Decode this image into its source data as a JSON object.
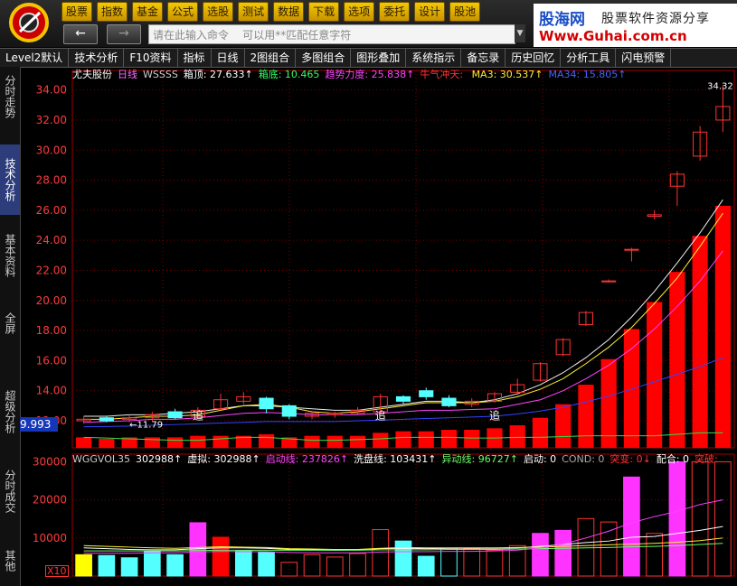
{
  "menu": [
    "股票",
    "指数",
    "基金",
    "公式",
    "选股",
    "测试",
    "数据",
    "下载",
    "选项",
    "委托",
    "设计",
    "股池"
  ],
  "command": {
    "placeholder": "请在此输入命令    可以用**匹配任意字符"
  },
  "nav": {
    "back": "←",
    "forward": "→"
  },
  "brand": {
    "name": "股海网",
    "slogan": "股票软件资源分享",
    "url": "Www.Guhai.com.cn"
  },
  "toolbar": [
    "Level2默认",
    "技术分析",
    "F10资料",
    "指标",
    "日线",
    "2图组合",
    "多图组合",
    "图形叠加",
    "系统指示",
    "备忘录",
    "历史回忆",
    "分析工具",
    "闪电预警"
  ],
  "left_tabs": [
    "分时走势",
    "技术分析",
    "基本资料",
    "全屏",
    "超级分析",
    "分时成交",
    "其他"
  ],
  "main_legend": [
    {
      "text": "尤夫股份",
      "color": "#ffffff"
    },
    {
      "text": "日线",
      "color": "#ff66ff"
    },
    {
      "text": "WSSSS",
      "color": "#cccccc"
    },
    {
      "text": "箱顶: 27.633↑",
      "color": "#ffffff"
    },
    {
      "text": "箱底: 10.465",
      "color": "#33ff66"
    },
    {
      "text": "趋势力度: 25.838↑",
      "color": "#ff44ff"
    },
    {
      "text": "牛气冲天: ",
      "color": "#ff3333"
    },
    {
      "text": "MA3: 30.537↑",
      "color": "#ffee33"
    },
    {
      "text": "MA34: 15.805↑",
      "color": "#4466ff"
    }
  ],
  "vol_legend": [
    {
      "text": "WGGVOL35",
      "color": "#cccccc"
    },
    {
      "text": "302988↑",
      "color": "#ffffff"
    },
    {
      "text": "虚拟: 302988↑",
      "color": "#ffffff"
    },
    {
      "text": "启动线: 237826↑",
      "color": "#ff44ff"
    },
    {
      "text": "洗盘线: 103431↑",
      "color": "#ffffff"
    },
    {
      "text": "异动线: 96727↑",
      "color": "#66ff66"
    },
    {
      "text": "启动: 0",
      "color": "#ffffff"
    },
    {
      "text": "COND: 0",
      "color": "#aaaaaa"
    },
    {
      "text": "突变: 0↓",
      "color": "#ff3333"
    },
    {
      "text": "配合: 0",
      "color": "#ffffff"
    },
    {
      "text": "突破: ",
      "color": "#ff3333"
    }
  ],
  "current_price_label": "9.993",
  "annotations": {
    "low_price": "←11.79",
    "high_price": "34.32",
    "zhui": "追"
  },
  "volume_scale_label": "X10",
  "colors": {
    "up": "#ff3333",
    "down": "#54ffff",
    "ma_white": "#f0f0f0",
    "ma_yellow": "#ffee33",
    "ma_blue": "#3344ff",
    "ma_green": "#33dd44",
    "ma_magenta": "#ff44ff",
    "grid": "#7a0000"
  },
  "chart_data": [
    {
      "type": "candlestick",
      "title": "",
      "ylim": [
        10.2,
        35.3
      ],
      "y_ticks": [
        34,
        32,
        30,
        28,
        26,
        24,
        22,
        20,
        18,
        16,
        14,
        12
      ],
      "y_tick_labels": [
        "34.00",
        "32.00",
        "30.00",
        "28.00",
        "26.00",
        "24.00",
        "22.00",
        "20.00",
        "18.00",
        "16.00",
        "14.00",
        "12.00"
      ],
      "candles": [
        {
          "o": 12.0,
          "c": 12.1,
          "h": 12.3,
          "l": 11.8
        },
        {
          "o": 12.2,
          "c": 12.0,
          "h": 12.3,
          "l": 11.9
        },
        {
          "o": 12.1,
          "c": 12.2,
          "h": 12.4,
          "l": 11.9
        },
        {
          "o": 12.2,
          "c": 12.4,
          "h": 12.6,
          "l": 12.0
        },
        {
          "o": 12.6,
          "c": 12.2,
          "h": 12.8,
          "l": 12.1
        },
        {
          "o": 12.3,
          "c": 12.7,
          "h": 12.9,
          "l": 12.2
        },
        {
          "o": 12.8,
          "c": 13.4,
          "h": 13.8,
          "l": 12.7
        },
        {
          "o": 13.3,
          "c": 13.6,
          "h": 13.9,
          "l": 13.1
        },
        {
          "o": 13.5,
          "c": 12.8,
          "h": 13.6,
          "l": 12.5
        },
        {
          "o": 13.0,
          "c": 12.3,
          "h": 13.1,
          "l": 12.1
        },
        {
          "o": 12.3,
          "c": 12.5,
          "h": 12.6,
          "l": 12.1
        },
        {
          "o": 12.4,
          "c": 12.5,
          "h": 12.6,
          "l": 12.2
        },
        {
          "o": 12.5,
          "c": 12.7,
          "h": 12.9,
          "l": 12.4
        },
        {
          "o": 12.6,
          "c": 13.6,
          "h": 13.8,
          "l": 12.5
        },
        {
          "o": 13.6,
          "c": 13.3,
          "h": 13.7,
          "l": 13.1
        },
        {
          "o": 14.0,
          "c": 13.6,
          "h": 14.2,
          "l": 13.4
        },
        {
          "o": 13.5,
          "c": 13.0,
          "h": 13.7,
          "l": 12.9
        },
        {
          "o": 13.1,
          "c": 13.3,
          "h": 13.5,
          "l": 12.9
        },
        {
          "o": 13.3,
          "c": 13.8,
          "h": 13.9,
          "l": 13.2
        },
        {
          "o": 13.9,
          "c": 14.4,
          "h": 14.8,
          "l": 13.7
        },
        {
          "o": 14.7,
          "c": 15.8,
          "h": 15.9,
          "l": 14.6
        },
        {
          "o": 16.4,
          "c": 17.4,
          "h": 17.5,
          "l": 16.3
        },
        {
          "o": 18.4,
          "c": 19.2,
          "h": 19.3,
          "l": 18.3
        },
        {
          "o": 21.3,
          "c": 21.3,
          "h": 21.4,
          "l": 21.2
        },
        {
          "o": 23.4,
          "c": 23.4,
          "h": 23.5,
          "l": 22.6
        },
        {
          "o": 25.6,
          "c": 25.7,
          "h": 26.0,
          "l": 25.4
        },
        {
          "o": 27.6,
          "c": 28.4,
          "h": 28.6,
          "l": 26.3
        },
        {
          "o": 29.6,
          "c": 31.2,
          "h": 31.6,
          "l": 29.3
        },
        {
          "o": 32.0,
          "c": 32.9,
          "h": 34.32,
          "l": 31.2
        }
      ],
      "trend_bars": [
        10.9,
        10.8,
        10.9,
        10.9,
        10.9,
        11.0,
        11.0,
        11.0,
        11.1,
        10.9,
        11.0,
        11.0,
        11.0,
        11.2,
        11.3,
        11.3,
        11.4,
        11.4,
        11.5,
        11.7,
        12.2,
        13.1,
        14.4,
        16.1,
        18.1,
        19.9,
        21.9,
        24.3,
        26.3
      ],
      "trend_base": [
        10.9,
        10.85,
        10.8,
        10.75,
        10.7,
        10.7,
        10.8,
        10.9,
        10.9,
        10.8,
        10.7,
        10.7,
        10.75,
        10.8,
        10.9,
        10.9,
        10.9,
        10.85,
        10.85,
        10.9,
        10.9,
        10.95,
        11.0,
        11.0,
        11.0,
        11.0,
        11.1,
        11.2,
        11.2
      ],
      "lines": [
        {
          "color": "#f0f0f0",
          "values": [
            12.3,
            12.3,
            12.4,
            12.4,
            12.5,
            12.6,
            12.8,
            13.0,
            13.0,
            12.9,
            12.8,
            12.7,
            12.7,
            12.9,
            13.1,
            13.3,
            13.3,
            13.2,
            13.4,
            13.8,
            14.4,
            15.2,
            16.2,
            17.4,
            18.9,
            20.6,
            22.5,
            24.5,
            26.7
          ]
        },
        {
          "color": "#ffee33",
          "values": [
            12.1,
            12.1,
            12.2,
            12.3,
            12.3,
            12.4,
            12.7,
            13.0,
            13.1,
            12.9,
            12.6,
            12.5,
            12.6,
            12.8,
            13.0,
            13.2,
            13.2,
            13.2,
            13.3,
            13.6,
            14.1,
            14.8,
            15.8,
            16.9,
            18.2,
            19.8,
            21.5,
            23.6,
            25.8
          ]
        },
        {
          "color": "#ff44ff",
          "values": [
            11.9,
            11.95,
            12.0,
            12.1,
            12.1,
            12.2,
            12.35,
            12.5,
            12.55,
            12.5,
            12.4,
            12.4,
            12.4,
            12.5,
            12.6,
            12.7,
            12.7,
            12.75,
            12.8,
            13.1,
            13.4,
            14.0,
            14.8,
            15.7,
            16.8,
            18.1,
            19.6,
            21.3,
            23.3
          ]
        },
        {
          "color": "#3344ff",
          "values": [
            11.6,
            11.62,
            11.65,
            11.7,
            11.75,
            11.8,
            11.85,
            11.9,
            11.95,
            11.95,
            11.95,
            11.95,
            12.0,
            12.05,
            12.1,
            12.15,
            12.2,
            12.25,
            12.3,
            12.45,
            12.65,
            12.9,
            13.25,
            13.65,
            14.1,
            14.6,
            15.1,
            15.6,
            16.2
          ]
        },
        {
          "color": "#33dd44",
          "values": [
            10.9,
            10.85,
            10.8,
            10.75,
            10.7,
            10.7,
            10.8,
            10.9,
            10.9,
            10.8,
            10.7,
            10.7,
            10.75,
            10.8,
            10.9,
            10.9,
            10.9,
            10.85,
            10.85,
            10.9,
            10.9,
            10.95,
            11.0,
            11.0,
            11.0,
            11.0,
            11.1,
            11.2,
            11.2
          ]
        }
      ]
    },
    {
      "type": "bar",
      "title": "",
      "ylim": [
        0,
        32000
      ],
      "y_ticks": [
        30000,
        20000,
        10000
      ],
      "y_tick_labels": [
        "30000",
        "20000",
        "10000"
      ],
      "volume": [
        5600,
        5400,
        4800,
        6500,
        5600,
        14000,
        10200,
        6600,
        6200,
        3600,
        5600,
        5000,
        5900,
        12200,
        9200,
        5200,
        7300,
        7200,
        6800,
        8000,
        11200,
        12000,
        15100,
        14200,
        26000,
        11200,
        30000,
        30000,
        30000
      ],
      "volume_type": [
        "down",
        "down",
        "down",
        "down",
        "down",
        "up",
        "up",
        "down",
        "down",
        "up",
        "up",
        "up",
        "up",
        "up",
        "down",
        "down",
        "down",
        "up",
        "up",
        "up",
        "up",
        "up",
        "up",
        "up",
        "up",
        "up",
        "up",
        "up",
        "up"
      ],
      "volume_fill": [
        "#ffff00",
        "#54ffff",
        "#54ffff",
        "#54ffff",
        "#54ffff",
        "#ff33ff",
        "#ff0000",
        "#54ffff",
        "#54ffff",
        "none",
        "none",
        "none",
        "none",
        "none",
        "#54ffff",
        "#54ffff",
        "none",
        "none",
        "none",
        "none",
        "#ff33ff",
        "#ff33ff",
        "none",
        "none",
        "#ff33ff",
        "none",
        "#ff33ff",
        "none",
        "none"
      ],
      "lines": [
        {
          "color": "#ffffff",
          "values": [
            7400,
            7200,
            7000,
            6900,
            6900,
            7200,
            7400,
            7400,
            7300,
            7000,
            6900,
            6800,
            6900,
            7200,
            7300,
            7200,
            7300,
            7300,
            7300,
            7400,
            7800,
            8300,
            8800,
            9200,
            10200,
            10400,
            11200,
            12000,
            13000
          ]
        },
        {
          "color": "#ffee33",
          "values": [
            8000,
            7800,
            7600,
            7400,
            7300,
            7500,
            7700,
            7600,
            7500,
            7200,
            7100,
            7000,
            7000,
            7300,
            7500,
            7400,
            7400,
            7400,
            7400,
            7500,
            7600,
            7800,
            8000,
            8200,
            8400,
            8600,
            8900,
            9300,
            10000
          ]
        },
        {
          "color": "#66ff66",
          "values": [
            6600,
            6600,
            6600,
            6600,
            6600,
            6700,
            6800,
            6800,
            6800,
            6800,
            6800,
            6800,
            6800,
            6900,
            6900,
            6900,
            7000,
            7000,
            7000,
            7100,
            7200,
            7300,
            7400,
            7500,
            7700,
            7800,
            8000,
            8300,
            8600
          ]
        },
        {
          "color": "#ff44ff",
          "values": [
            6000,
            6000,
            6000,
            6100,
            6100,
            6300,
            6500,
            6400,
            6400,
            6200,
            6100,
            6100,
            6100,
            6300,
            6400,
            6400,
            6500,
            6500,
            6600,
            6800,
            7400,
            8400,
            10000,
            11800,
            14000,
            15600,
            17000,
            18800,
            20000
          ]
        }
      ]
    }
  ]
}
